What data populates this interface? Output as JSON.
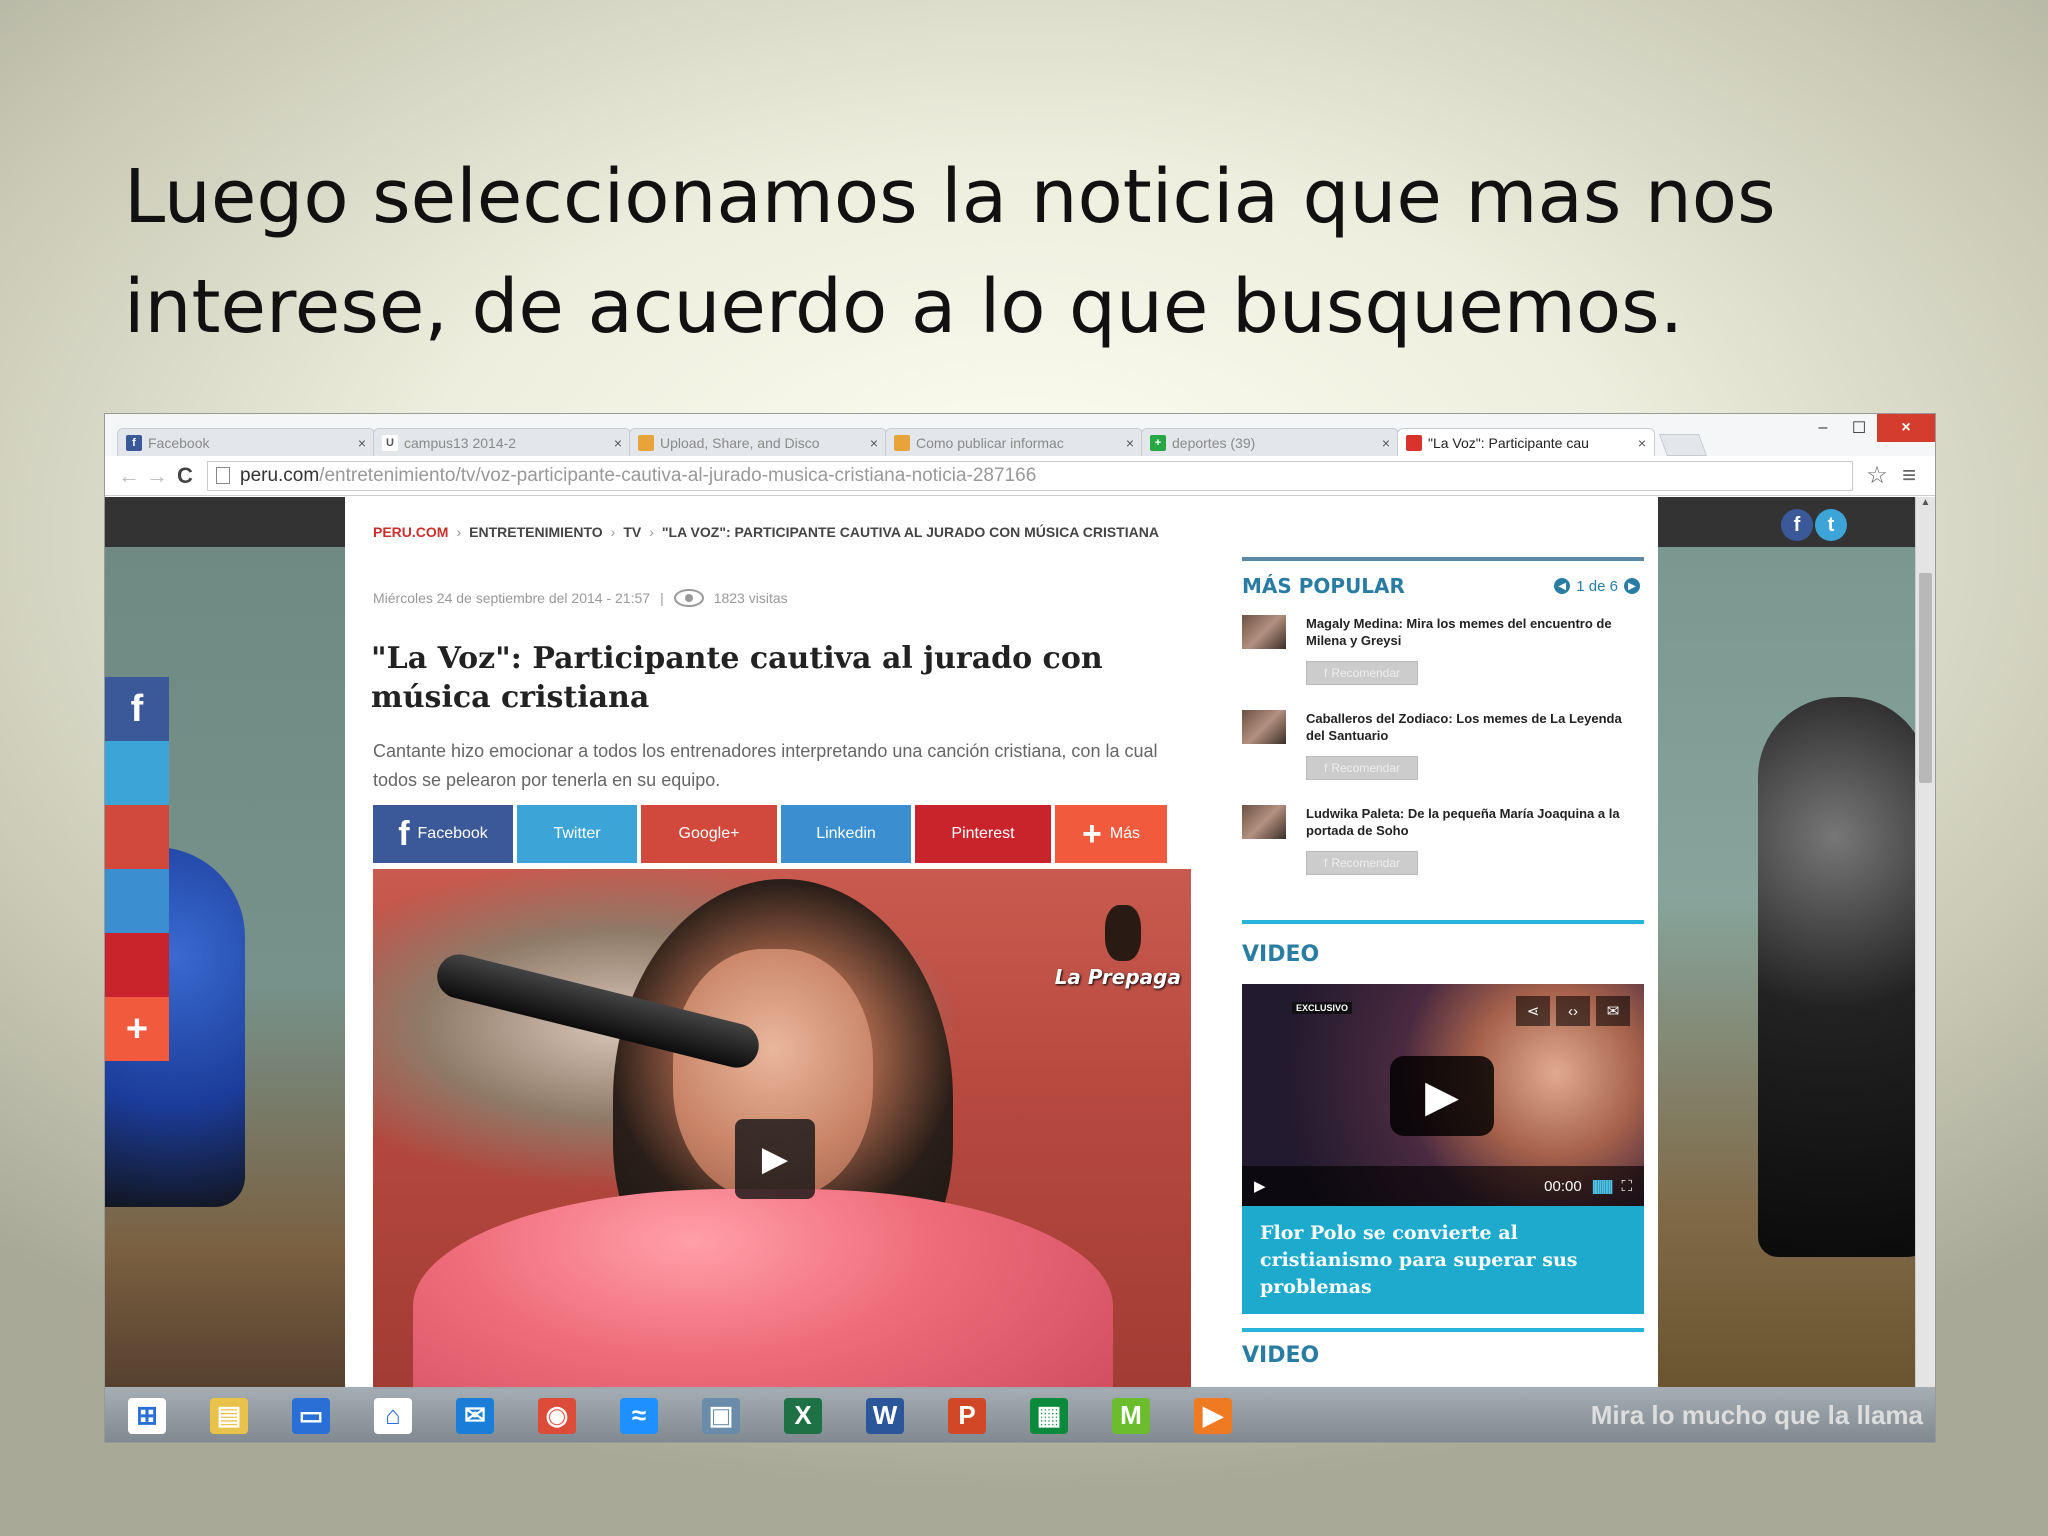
{
  "slide": {
    "title": "Luego seleccionamos la noticia que mas nos interese, de acuerdo a lo que busquemos."
  },
  "browser": {
    "window_controls": {
      "minimize": "–",
      "maximize": "☐",
      "close": "×"
    },
    "tabs": [
      {
        "label": "Facebook",
        "icon": "facebook-icon",
        "color": "#3b5998",
        "glyph": "f",
        "active": false
      },
      {
        "label": "campus13 2014-2",
        "icon": "campus-icon",
        "color": "#ffffff",
        "glyph": "U",
        "active": false
      },
      {
        "label": "Upload, Share, and Disco",
        "icon": "slideshare-icon",
        "color": "#e8a33a",
        "glyph": "",
        "active": false
      },
      {
        "label": "Como publicar informac",
        "icon": "slideshare-icon",
        "color": "#e8a33a",
        "glyph": "",
        "active": false
      },
      {
        "label": "deportes (39)",
        "icon": "plus-icon",
        "color": "#27a844",
        "glyph": "+",
        "active": false
      },
      {
        "label": "\"La Voz\": Participante cau",
        "icon": "peru-com-icon",
        "color": "#d9342b",
        "glyph": "",
        "active": true
      }
    ],
    "url_host": "peru.com",
    "url_path": "/entretenimiento/tv/voz-participante-cautiva-al-jurado-musica-cristiana-noticia-287166"
  },
  "article": {
    "breadcrumb": [
      "PERU.COM",
      "ENTRETENIMIENTO",
      "TV",
      "\"LA VOZ\": PARTICIPANTE CAUTIVA AL JURADO CON MÚSICA CRISTIANA"
    ],
    "date": "Miércoles 24 de septiembre del 2014 - 21:57",
    "meta_separator": "|",
    "views": "1823 visitas",
    "headline": "\"La Voz\": Participante cautiva al jurado con música cristiana",
    "summary": "Cantante hizo emocionar a todos los entrenadores interpretando una canción cristiana, con la cual todos se pelearon por tenerla en su equipo.",
    "share_buttons": [
      {
        "label": "Facebook",
        "color": "#3b5998"
      },
      {
        "label": "Twitter",
        "color": "#3da4d8"
      },
      {
        "label": "Google+",
        "color": "#d1493c"
      },
      {
        "label": "Linkedin",
        "color": "#3b8fd0"
      },
      {
        "label": "Pinterest",
        "color": "#c9242b"
      },
      {
        "label": "Más",
        "color": "#f25a3d"
      }
    ],
    "photo_watermark": "La Prepaga"
  },
  "side_share": {
    "colors": [
      "#3b5998",
      "#3da4d8",
      "#d1493c",
      "#3b8fd0",
      "#c9242b",
      "#f25a3d"
    ]
  },
  "sidebar": {
    "popular_title": "MÁS POPULAR",
    "pager": "1 de 6",
    "popular_items": [
      {
        "text": "Magaly Medina: Mira los memes del encuentro de Milena y Greysi",
        "recommend": "Recomendar"
      },
      {
        "text": "Caballeros del Zodiaco: Los memes de La Leyenda del Santuario",
        "recommend": "Recomendar"
      },
      {
        "text": "Ludwika Paleta: De la pequeña María Joaquina a la portada de Soho",
        "recommend": "Recomendar"
      }
    ],
    "video_title": "VIDEO",
    "video_badge": "EXCLUSIVO",
    "video_time": "00:00",
    "video_caption": "Flor Polo se convierte al cristianismo para superar sus problemas",
    "video2_title": "VIDEO"
  },
  "taskbar": {
    "icons": [
      {
        "name": "windows-start-icon",
        "color": "#ffffff",
        "glyph": "⊞"
      },
      {
        "name": "file-explorer-icon",
        "color": "#e8c24a",
        "glyph": "▤"
      },
      {
        "name": "desktop-icon",
        "color": "#2a6fd6",
        "glyph": "▭"
      },
      {
        "name": "home-icon",
        "color": "#ffffff",
        "glyph": "⌂"
      },
      {
        "name": "outlook-icon",
        "color": "#1a7ed8",
        "glyph": "✉"
      },
      {
        "name": "chrome-icon",
        "color": "#dd4b39",
        "glyph": "◉"
      },
      {
        "name": "app-icon",
        "color": "#1e90ff",
        "glyph": "≈"
      },
      {
        "name": "photo-viewer-icon",
        "color": "#6a8ca8",
        "glyph": "▣"
      },
      {
        "name": "excel-icon",
        "color": "#1e7145",
        "glyph": "X"
      },
      {
        "name": "word-icon",
        "color": "#2b579a",
        "glyph": "W"
      },
      {
        "name": "powerpoint-icon",
        "color": "#d24726",
        "glyph": "P"
      },
      {
        "name": "store-icon",
        "color": "#0a8a3a",
        "glyph": "▦"
      },
      {
        "name": "movistar-icon",
        "color": "#6bbd2e",
        "glyph": "M"
      },
      {
        "name": "media-player-icon",
        "color": "#f07a21",
        "glyph": "▶"
      }
    ],
    "tray_text": "Mira lo mucho que la llama"
  }
}
